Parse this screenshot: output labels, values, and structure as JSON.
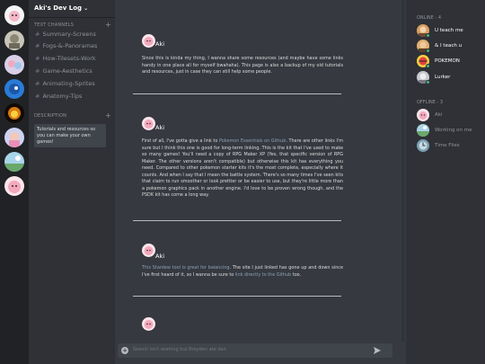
{
  "guild": {
    "name": "Aki's Dev Log"
  },
  "sidebar": {
    "text_channels_label": "TEXT CHANNELS",
    "channels": [
      "Summary-Screens",
      "Fogs-&-Panoramas",
      "How-Tilesets-Work",
      "Game-Aesthetics",
      "Animating-Sprites",
      "Anatomy-Tips"
    ],
    "description_label": "DESCRIPTION",
    "description_text": "Tutorials and resources so you can make your own games!"
  },
  "posts": [
    {
      "author": "Aki",
      "segments": [
        {
          "t": "Since this is kinda my thing, I wanna share some resources (and maybe have some links handy in one place all for myself bwahaha). This page is also a backup of my old tutorials and resources, just in case they can still help some people."
        }
      ]
    },
    {
      "author": "Aki",
      "segments": [
        {
          "t": "First of all, I've gotta give a link to "
        },
        {
          "t": "Pokemon Essentials on Github",
          "link": true
        },
        {
          "t": ". There are other links I'm sure but I think this one is good for long-term linking. This is the kit that I've used to make so many games! You'll need a copy of RPG Maker XP (Yes, that specific version of RPG Maker. The other versions aren't compatible) but otherwise this kit has everything you need. Compared to other pokemon starter kits it's the most complete, especially where it counts. And when I say that I mean the battle system. There's so many times I've seen kits that claim to run smoother or look prettier or be easier to use, but they're little more than a pokemon graphics pack in another engine. I'd love to be proven wrong though, and the PSDK kit has come a long way."
        }
      ]
    },
    {
      "author": "Aki",
      "segments": [
        {
          "t": "This Stardew tool is great for balancing",
          "link": true
        },
        {
          "t": ". The site I just linked has gone up and down since I've first heard of it, so I wanna be sure to "
        },
        {
          "t": "link directly to the Github",
          "link": true
        },
        {
          "t": " too."
        }
      ]
    }
  ],
  "composer": {
    "placeholder": "Search isn't working but Brayden ate dan"
  },
  "members": {
    "online_label": "ONLINE - 4",
    "online": [
      "U teach me",
      "& I teach u",
      "POKEMON",
      "Lurker"
    ],
    "offline_label": "OFFLINE - 3",
    "offline": [
      "Aki",
      "Working on me",
      "Time Flies"
    ]
  },
  "colors": {
    "link": "#8aa0b8",
    "online": "#43b581",
    "background": "#36393f"
  },
  "icons": {
    "channel": "hash-icon",
    "add": "plus-icon",
    "send": "send-icon",
    "collapse": "chevron-down-icon"
  }
}
